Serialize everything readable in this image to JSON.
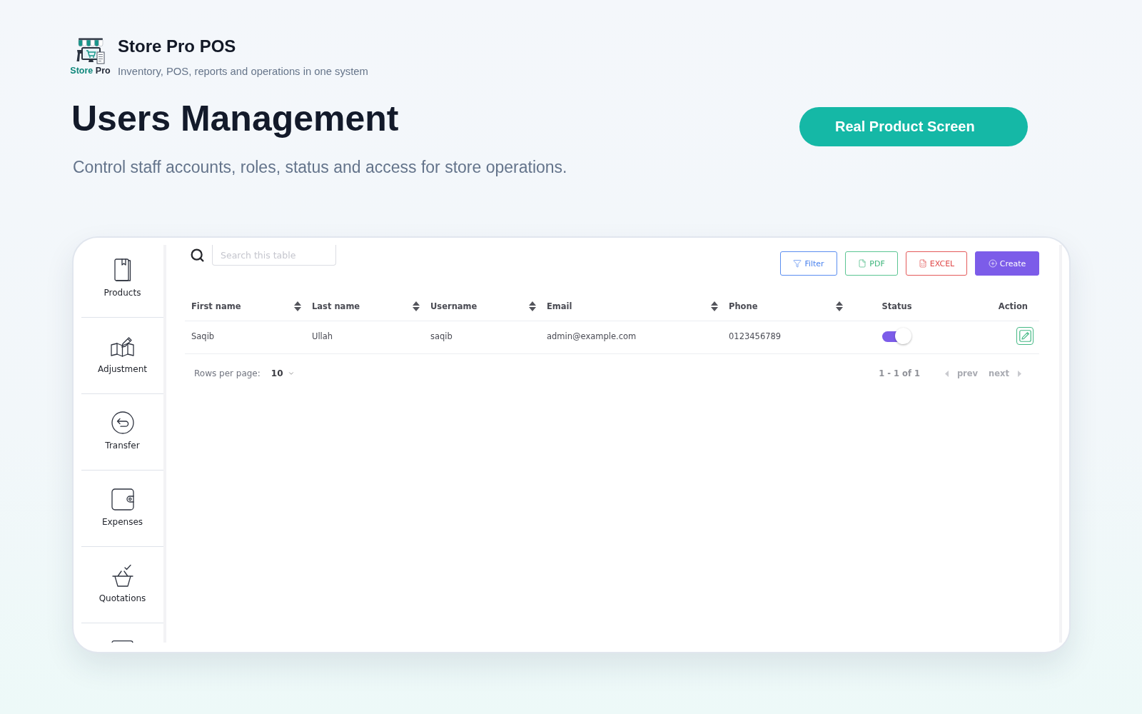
{
  "brand": {
    "logo_words": [
      "Store",
      "Pro"
    ],
    "title": "Store Pro POS",
    "tagline": "Inventory, POS, reports and operations in one system"
  },
  "hero": {
    "title": "Users Management",
    "subtitle": "Control staff accounts, roles, status and access for store operations.",
    "button": "Real Product Screen"
  },
  "app": {
    "sidebar": {
      "items": [
        {
          "label": "Products",
          "selected": false
        },
        {
          "label": "Adjustment",
          "selected": false
        },
        {
          "label": "Transfer",
          "selected": false
        },
        {
          "label": "Expenses",
          "selected": false
        },
        {
          "label": "Quotations",
          "selected": false
        }
      ]
    },
    "search": {
      "placeholder": "Search this table"
    },
    "toolbar_buttons": [
      {
        "kind": "filter",
        "label": "Filter"
      },
      {
        "kind": "pdf",
        "label": "PDF"
      },
      {
        "kind": "excel",
        "label": "EXCEL"
      },
      {
        "kind": "create",
        "label": "Create"
      }
    ],
    "table": {
      "columns": [
        {
          "label": "First name",
          "kind": "text",
          "sortable": true
        },
        {
          "label": "Last name",
          "kind": "text",
          "sortable": true
        },
        {
          "label": "Username",
          "kind": "text",
          "sortable": true
        },
        {
          "label": "Email",
          "kind": "text",
          "sortable": true
        },
        {
          "label": "Phone",
          "kind": "text",
          "sortable": true
        },
        {
          "label": "Status",
          "kind": "toggle",
          "sortable": false
        },
        {
          "label": "Action",
          "kind": "action",
          "sortable": false
        }
      ],
      "rows": [
        {
          "cells": [
            "Saqib",
            "Ullah",
            "saqib",
            "admin@example.com",
            "0123456789"
          ],
          "active": true
        }
      ]
    },
    "pagination": {
      "rows_per_page_label": "Rows per page:",
      "rows_per_page": "10",
      "range": "1 - 1 of 1",
      "prev": "prev",
      "next": "next"
    }
  }
}
